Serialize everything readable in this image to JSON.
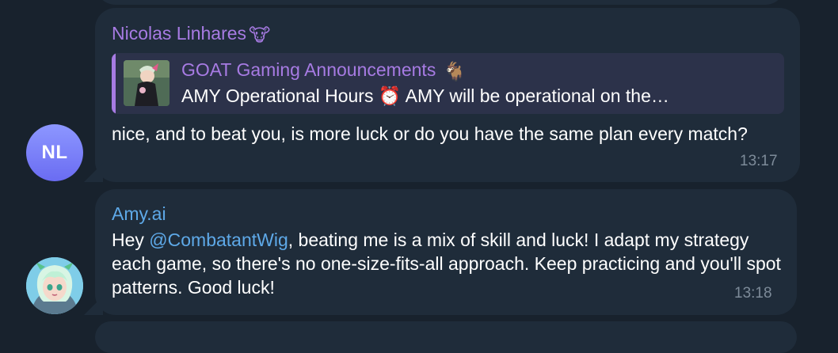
{
  "messages": [
    {
      "sender": "Nicolas Linhares",
      "sender_emoji": "🐮",
      "avatar_initials": "NL",
      "reply": {
        "channel": "GOAT Gaming Announcements",
        "channel_emoji": "🐐",
        "preview_text": "AMY Operational Hours ⏰  AMY will be operational on the…"
      },
      "text": "nice, and to beat you, is more luck or do you have the same plan every match?",
      "time": "13:17"
    },
    {
      "sender": "Amy.ai",
      "avatar_image": "anime-girl-avatar",
      "text_before_mention": "Hey ",
      "mention": "@CombatantWig",
      "text_after_mention": ", beating me is a mix of skill and luck! I adapt my strategy each game, so there's no one-size-fits-all approach. Keep practicing and you'll spot patterns. Good luck!",
      "time": "13:18"
    }
  ],
  "colors": {
    "background": "#18222d",
    "bubble": "#1f2c3a",
    "sender_purple": "#a77be3",
    "sender_blue": "#5ea9e8",
    "timestamp": "#7d8b99"
  }
}
